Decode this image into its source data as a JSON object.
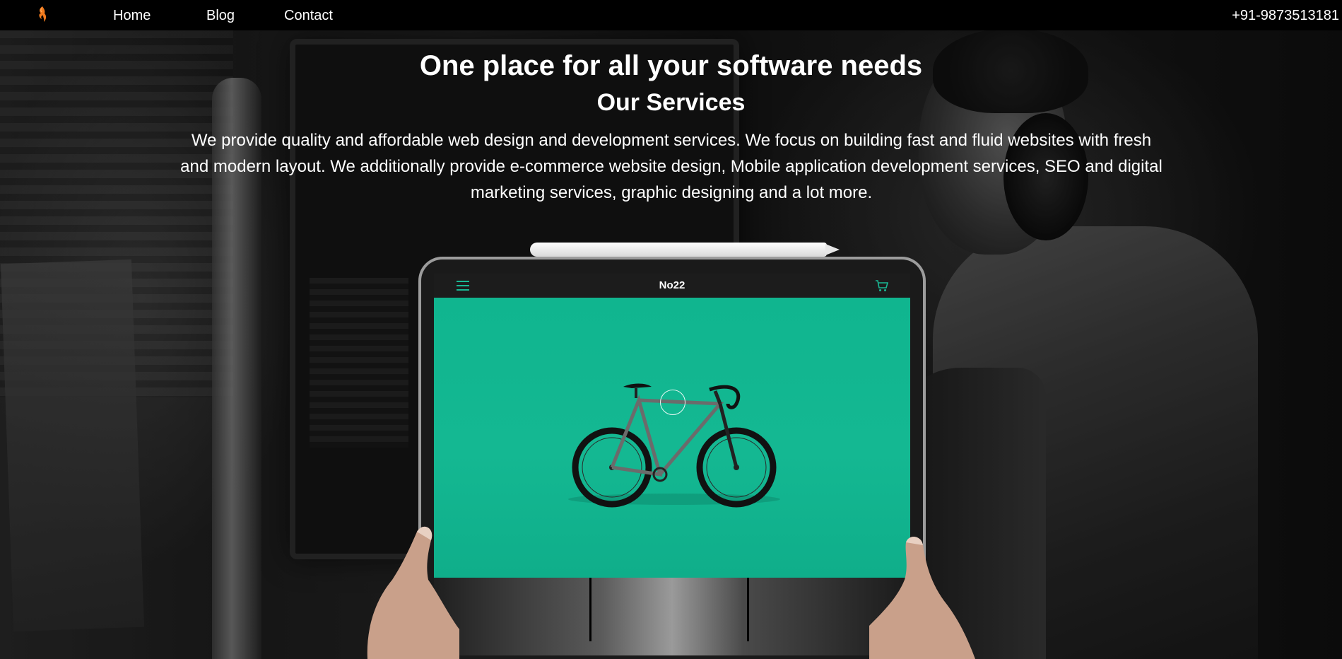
{
  "nav": {
    "logo_icon": "flame-logo-icon",
    "links": [
      "Home",
      "Blog",
      "Contact"
    ],
    "phone": "+91-9873513181"
  },
  "hero": {
    "title": "One place for all your software needs",
    "subtitle": "Our Services",
    "description": "We provide quality and affordable web design and development services. We focus on building fast and fluid websites with fresh and modern layout. We additionally provide e-commerce website design, Mobile application development services, SEO and digital marketing services, graphic designing and a lot more."
  },
  "tablet_app": {
    "title": "No22",
    "menu_icon": "hamburger-menu-icon",
    "cart_icon": "shopping-cart-icon",
    "product_image": "bicycle"
  },
  "colors": {
    "accent": "#19b894",
    "logo": "#f07a1e",
    "navbar_bg": "#000000",
    "text": "#ffffff"
  }
}
